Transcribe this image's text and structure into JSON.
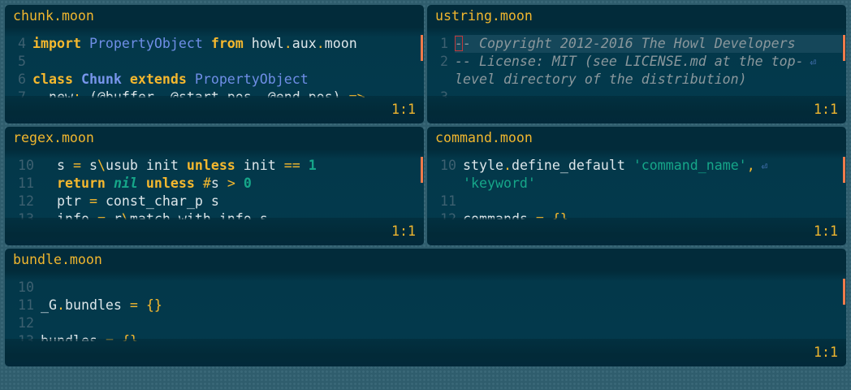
{
  "colors": {
    "accent": "#f0b62e",
    "background": "#022b3a",
    "scroll_marker": "#f07a4a"
  },
  "panels": [
    {
      "id": "chunk",
      "title": "chunk.moon",
      "position": "1:1",
      "lines": [
        {
          "num": "4",
          "tokens": [
            [
              "import",
              "kw"
            ],
            [
              " ",
              "plain"
            ],
            [
              "PropertyObject",
              "const"
            ],
            [
              " ",
              "plain"
            ],
            [
              "from",
              "kw"
            ],
            [
              " howl",
              "plain"
            ],
            [
              ".",
              "op"
            ],
            [
              "aux",
              "plain"
            ],
            [
              ".",
              "op"
            ],
            [
              "moon",
              "plain"
            ]
          ]
        },
        {
          "num": "5",
          "tokens": []
        },
        {
          "num": "6",
          "tokens": [
            [
              "class",
              "kw"
            ],
            [
              " ",
              "plain"
            ],
            [
              "Chunk",
              "cls"
            ],
            [
              " ",
              "plain"
            ],
            [
              "extends",
              "kw"
            ],
            [
              " ",
              "plain"
            ],
            [
              "PropertyObject",
              "const"
            ]
          ]
        },
        {
          "num": "7",
          "tokens": [
            [
              "  new",
              "plain"
            ],
            [
              ": ",
              "op"
            ],
            [
              "(@buffer, @start_pos, @end_pos) ",
              "plain"
            ],
            [
              "=>",
              "op"
            ]
          ]
        }
      ]
    },
    {
      "id": "ustring",
      "title": "ustring.moon",
      "position": "1:1",
      "lines": [
        {
          "num": "1",
          "current": true,
          "tokens": [
            [
              "-",
              "cmt cursor"
            ],
            [
              "- Copyright 2012-2016 The Howl Developers",
              "cmt"
            ]
          ]
        },
        {
          "num": "2",
          "tokens": [
            [
              "-- License: MIT (see LICENSE.md at the top-",
              "cmt"
            ],
            [
              " ⏎",
              "wrap"
            ]
          ]
        },
        {
          "num": "",
          "tokens": [
            [
              "level directory of the distribution)",
              "cmt"
            ]
          ]
        },
        {
          "num": "3",
          "tokens": []
        }
      ]
    },
    {
      "id": "regex",
      "title": "regex.moon",
      "position": "1:1",
      "lines": [
        {
          "num": "10",
          "tokens": [
            [
              "  s ",
              "plain"
            ],
            [
              "=",
              "op"
            ],
            [
              " s",
              "plain"
            ],
            [
              "\\",
              "op"
            ],
            [
              "usub init ",
              "plain"
            ],
            [
              "unless",
              "kw"
            ],
            [
              " init ",
              "plain"
            ],
            [
              "==",
              "op"
            ],
            [
              " ",
              "plain"
            ],
            [
              "1",
              "num-lit"
            ]
          ]
        },
        {
          "num": "11",
          "tokens": [
            [
              "  ",
              "plain"
            ],
            [
              "return",
              "kw"
            ],
            [
              " ",
              "plain"
            ],
            [
              "nil",
              "nil"
            ],
            [
              " ",
              "plain"
            ],
            [
              "unless",
              "kw"
            ],
            [
              " ",
              "plain"
            ],
            [
              "#",
              "op"
            ],
            [
              "s ",
              "plain"
            ],
            [
              ">",
              "op"
            ],
            [
              " ",
              "plain"
            ],
            [
              "0",
              "num-lit"
            ]
          ]
        },
        {
          "num": "12",
          "tokens": [
            [
              "  ptr ",
              "plain"
            ],
            [
              "=",
              "op"
            ],
            [
              " const_char_p s",
              "plain"
            ]
          ]
        },
        {
          "num": "13",
          "tokens": [
            [
              "  info ",
              "plain"
            ],
            [
              "=",
              "op"
            ],
            [
              " r",
              "plain"
            ],
            [
              "\\",
              "op"
            ],
            [
              "match_with_info s",
              "plain"
            ]
          ]
        }
      ]
    },
    {
      "id": "command",
      "title": "command.moon",
      "position": "1:1",
      "lines": [
        {
          "num": "10",
          "tokens": [
            [
              "style",
              "plain"
            ],
            [
              ".",
              "op"
            ],
            [
              "define_default ",
              "plain"
            ],
            [
              "'command_name'",
              "str"
            ],
            [
              ",",
              "op"
            ],
            [
              " ⏎",
              "wrap"
            ]
          ]
        },
        {
          "num": "",
          "tokens": [
            [
              "'keyword'",
              "str"
            ]
          ]
        },
        {
          "num": "11",
          "tokens": []
        },
        {
          "num": "12",
          "tokens": [
            [
              "commands ",
              "plain"
            ],
            [
              "=",
              "op"
            ],
            [
              " ",
              "plain"
            ],
            [
              "{}",
              "op"
            ]
          ]
        }
      ]
    },
    {
      "id": "bundle",
      "title": "bundle.moon",
      "position": "1:1",
      "lines": [
        {
          "num": "10",
          "tokens": []
        },
        {
          "num": "11",
          "tokens": [
            [
              "_G",
              "plain"
            ],
            [
              ".",
              "op"
            ],
            [
              "bundles ",
              "plain"
            ],
            [
              "=",
              "op"
            ],
            [
              " ",
              "plain"
            ],
            [
              "{}",
              "op"
            ]
          ]
        },
        {
          "num": "12",
          "tokens": []
        },
        {
          "num": "13",
          "tokens": [
            [
              "bundles ",
              "plain"
            ],
            [
              "=",
              "op"
            ],
            [
              " ",
              "plain"
            ],
            [
              "{}",
              "op"
            ]
          ]
        }
      ]
    }
  ]
}
